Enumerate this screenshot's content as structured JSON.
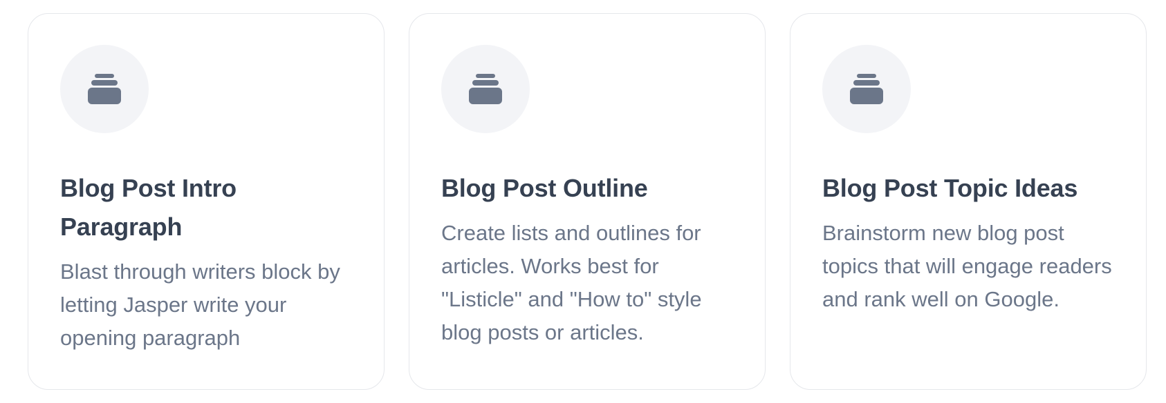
{
  "colors": {
    "title": "#364152",
    "description": "#6b7689",
    "icon": "#6b7689",
    "icon_background": "#f3f4f7",
    "card_border": "#e5e7eb"
  },
  "cards": [
    {
      "icon": "inbox-tray-icon",
      "title": "Blog Post Intro Paragraph",
      "description": "Blast through writers block by letting Jasper write your opening paragraph"
    },
    {
      "icon": "inbox-tray-icon",
      "title": "Blog Post Outline",
      "description": "Create lists and outlines for articles. Works best for \"Listicle\" and \"How to\" style blog posts or articles."
    },
    {
      "icon": "inbox-tray-icon",
      "title": "Blog Post Topic Ideas",
      "description": "Brainstorm new blog post topics that will engage readers and rank well on Google."
    }
  ]
}
